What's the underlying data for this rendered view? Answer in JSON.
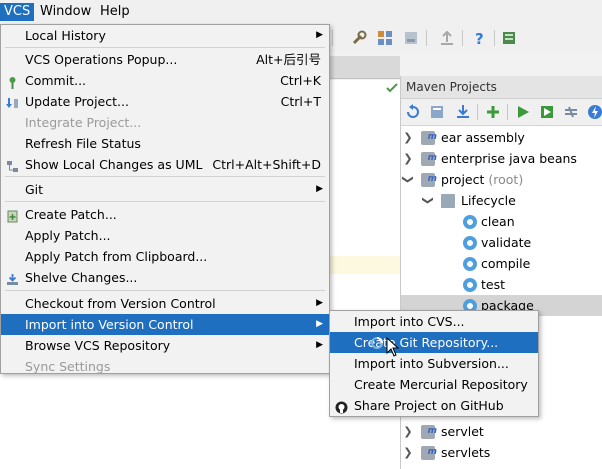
{
  "menubar": {
    "vcs": "VCS",
    "window": "Window",
    "help": "Help"
  },
  "vcs_menu": {
    "local_history": "Local History",
    "ops_popup": "VCS Operations Popup...",
    "ops_popup_sc": "Alt+后引号",
    "commit": "Commit...",
    "commit_sc": "Ctrl+K",
    "update": "Update Project...",
    "update_sc": "Ctrl+T",
    "integrate": "Integrate Project...",
    "refresh": "Refresh File Status",
    "show_uml": "Show Local Changes as UML",
    "show_uml_sc": "Ctrl+Alt+Shift+D",
    "git": "Git",
    "create_patch": "Create Patch...",
    "apply_patch": "Apply Patch...",
    "apply_patch_clip": "Apply Patch from Clipboard...",
    "shelve": "Shelve Changes...",
    "checkout": "Checkout from Version Control",
    "import_vc": "Import into Version Control",
    "browse": "Browse VCS Repository",
    "sync": "Sync Settings"
  },
  "submenu": {
    "import_cvs": "Import into CVS...",
    "create_git": "Create Git Repository...",
    "import_svn": "Import into Subversion...",
    "create_hg": "Create Mercurial Repository",
    "share_github": "Share Project on GitHub"
  },
  "maven": {
    "title": "Maven Projects",
    "items": {
      "ear": "ear assembly",
      "ejb": "enterprise java beans",
      "project": "project",
      "project_root": "(root)",
      "lifecycle": "Lifecycle",
      "clean": "clean",
      "validate": "validate",
      "compile": "compile",
      "test": "test",
      "package": "package",
      "servlet": "servlet",
      "servlets": "servlets"
    }
  },
  "colors": {
    "accent": "#1f6fc1",
    "menu_bg": "#f2f2f2",
    "selection_grey": "#d4d4d4"
  }
}
